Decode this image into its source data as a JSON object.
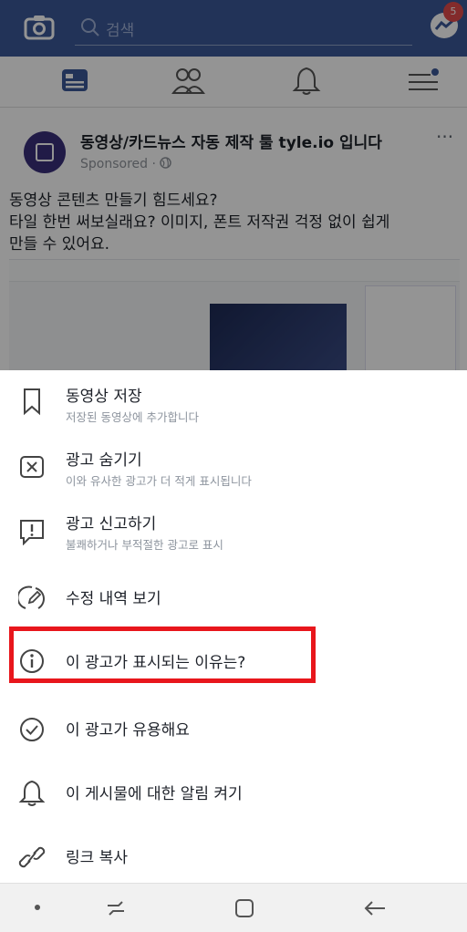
{
  "topbar": {
    "search_placeholder": "검색",
    "messenger_badge": "5"
  },
  "post": {
    "title": "동영상/카드뉴스 자동 제작 툴 tyle.io 입니다",
    "sponsored": "Sponsored · ",
    "more": "···",
    "body_line1": "동영상 콘텐츠 만들기 힘드세요?",
    "body_line2": "타일 한번 써보실래요? 이미지, 폰트 저작권 걱정 없이 쉽게",
    "body_line3": "만들 수 있어요."
  },
  "menu": {
    "items": [
      {
        "label": "동영상 저장",
        "sub": "저장된 동영상에 추가합니다",
        "icon": "bookmark-icon"
      },
      {
        "label": "광고 숨기기",
        "sub": "이와 유사한 광고가 더 적게 표시됩니다",
        "icon": "close-box-icon"
      },
      {
        "label": "광고 신고하기",
        "sub": "불쾌하거나 부적절한 광고로 표시",
        "icon": "report-icon"
      },
      {
        "label": "수정 내역 보기",
        "sub": "",
        "icon": "edit-history-icon"
      },
      {
        "label": "이 광고가 표시되는 이유는?",
        "sub": "",
        "icon": "info-icon"
      },
      {
        "label": "이 광고가 유용해요",
        "sub": "",
        "icon": "check-circle-icon"
      },
      {
        "label": "이 게시물에 대한 알림 켜기",
        "sub": "",
        "icon": "bell-icon"
      },
      {
        "label": "링크 복사",
        "sub": "",
        "icon": "link-icon"
      }
    ]
  },
  "colors": {
    "brand": "#3b5998",
    "highlight": "#e8161c",
    "badge": "#e24a4a"
  }
}
